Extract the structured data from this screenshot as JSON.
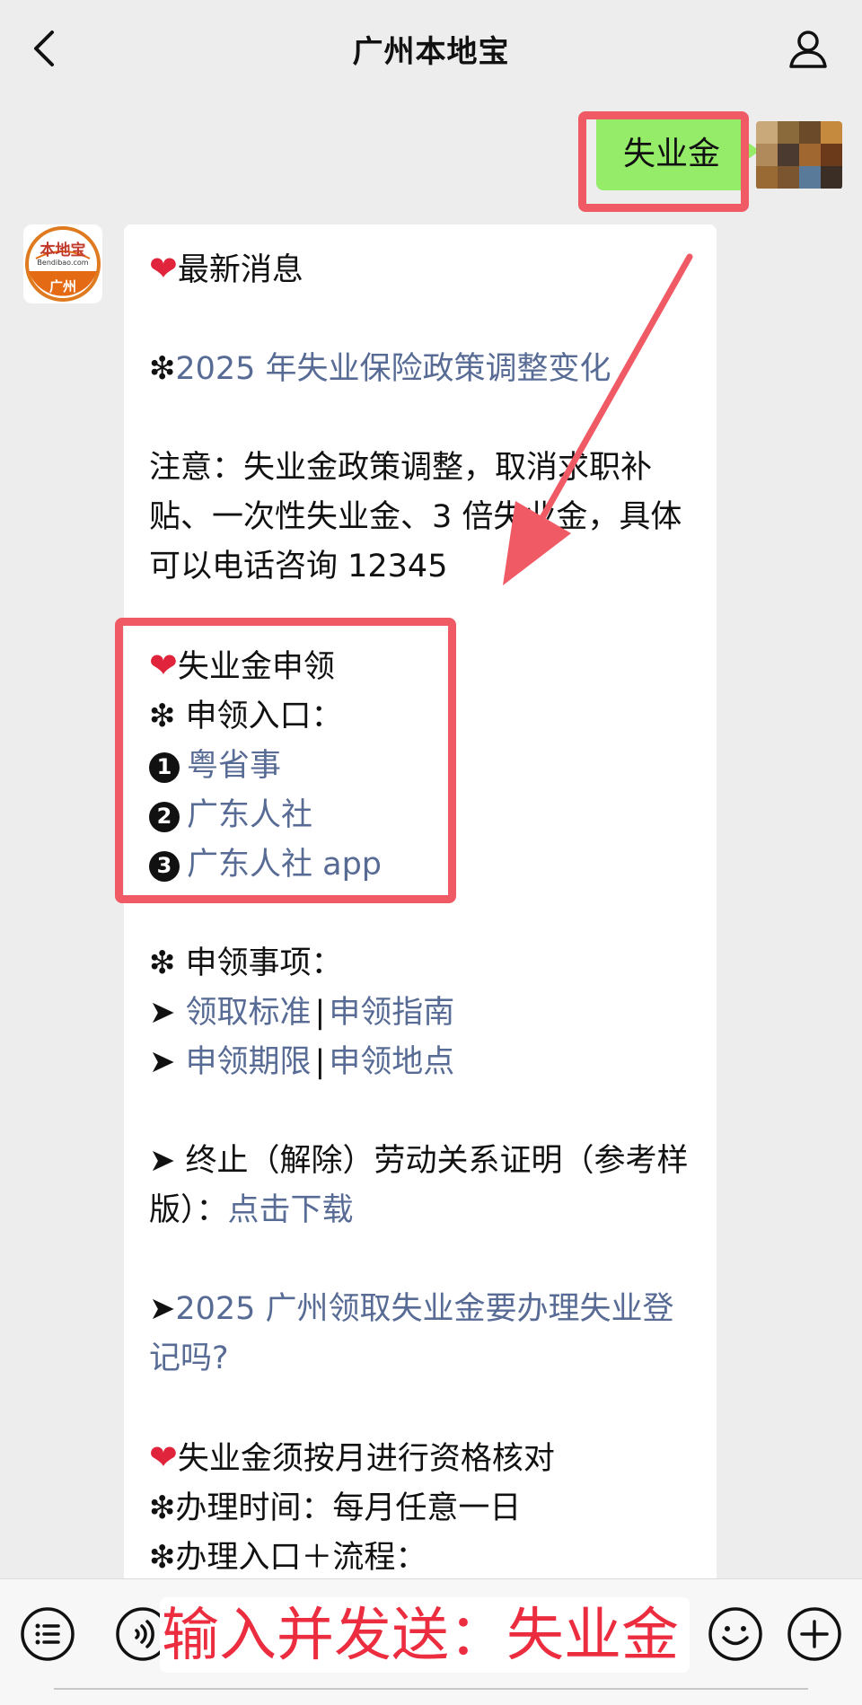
{
  "header": {
    "title": "广州本地宝"
  },
  "sent_message": {
    "text": "失业金"
  },
  "bot": {
    "avatar_top_text": "本地宝",
    "avatar_sub_text": "Bendibao.com",
    "avatar_city": "广州"
  },
  "message": {
    "latest_title": "最新消息",
    "policy_link": "2025 年失业保险政策调整变化",
    "notice": "注意：失业金政策调整，取消求职补贴、一次性失业金、3 倍失业金，具体可以电话咨询 12345",
    "apply_title": "失业金申领",
    "entry_label": "申领入口：",
    "entries": [
      "粤省事",
      "广东人社",
      "广东人社 app"
    ],
    "matters_label": "申领事项：",
    "matter_row1": [
      "领取标准",
      "申领指南"
    ],
    "matter_row2": [
      "申领期限",
      "申领地点"
    ],
    "certificate_text": "终止（解除）劳动关系证明（参考样版）：",
    "certificate_link": "点击下载",
    "registration_link": "2025 广州领取失业金要办理失业登记吗?",
    "verify_title": "失业金须按月进行资格核对",
    "verify_time": "办理时间：每月任意一日",
    "verify_entry": "办理入口＋流程："
  },
  "input": {
    "overlay_text": "输入并发送：失业金"
  },
  "colors": {
    "link": "#576b95",
    "highlight": "#f05a64",
    "sent_bubble": "#95ec69",
    "overlay_text": "#ec2c3f"
  },
  "icons": [
    "back-icon",
    "user-icon",
    "heart-icon",
    "arrow-icon",
    "menu-icon",
    "voice-icon",
    "emoji-icon",
    "plus-icon"
  ]
}
